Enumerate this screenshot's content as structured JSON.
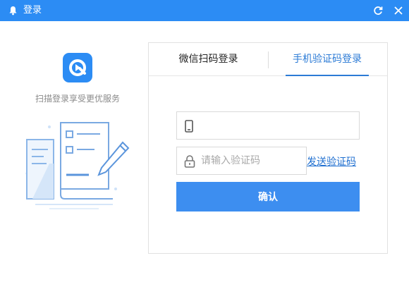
{
  "titlebar": {
    "title": "登录",
    "icons": {
      "left": "bell-icon",
      "refresh": "refresh-icon",
      "close": "close-icon"
    }
  },
  "left_panel": {
    "slogan": "扫描登录享受更优服务",
    "logo_icon": "app-logo-icon",
    "illustration_icon": "document-pencil-illustration"
  },
  "login": {
    "tabs": [
      {
        "label": "微信扫码登录",
        "active": false
      },
      {
        "label": "手机验证码登录",
        "active": true
      }
    ],
    "phone_field": {
      "value": "",
      "placeholder": "",
      "icon": "phone-icon"
    },
    "code_field": {
      "value": "",
      "placeholder": "请输入验证码",
      "icon": "lock-icon"
    },
    "send_code_label": "发送验证码",
    "confirm_label": "确认"
  },
  "colors": {
    "brand": "#2c8cf4",
    "button": "#3d8ef0",
    "link": "#1f6fd0",
    "active_tab": "#2c7bd6"
  }
}
